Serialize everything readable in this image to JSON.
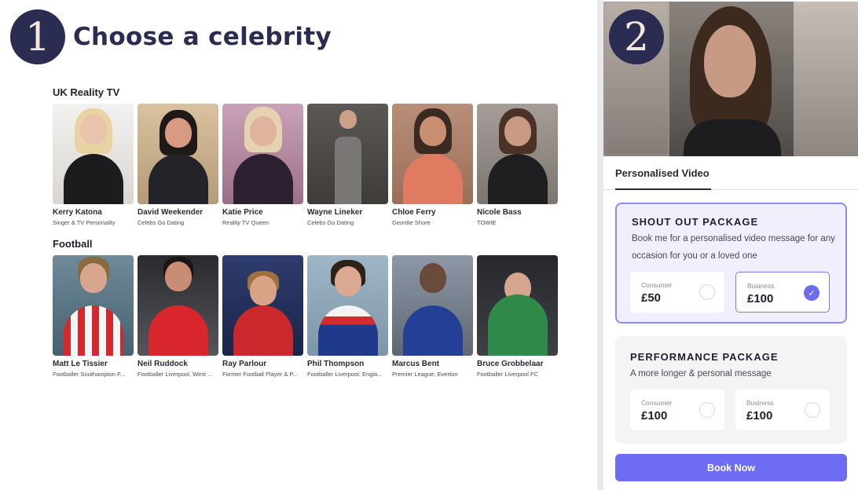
{
  "step1": {
    "number": "1",
    "title": "Choose a celebrity"
  },
  "step2": {
    "number": "2"
  },
  "sections": [
    {
      "title": "UK Reality TV",
      "celebs": [
        {
          "name": "Kerry Katona",
          "subtitle": "Singer & TV Personality"
        },
        {
          "name": "David Weekender",
          "subtitle": "Celebs Go Dating"
        },
        {
          "name": "Katie Price",
          "subtitle": "Reality TV Queen"
        },
        {
          "name": "Wayne Lineker",
          "subtitle": "Celebs Go Dating"
        },
        {
          "name": "Chloe Ferry",
          "subtitle": "Geordie Shore"
        },
        {
          "name": "Nicole Bass",
          "subtitle": "TOWIE"
        }
      ]
    },
    {
      "title": "Football",
      "celebs": [
        {
          "name": "Matt Le Tissier",
          "subtitle": "Footballer Southampton F..."
        },
        {
          "name": "Neil Ruddock",
          "subtitle": "Footballer Liverpool, West ..."
        },
        {
          "name": "Ray Parlour",
          "subtitle": "Former Football Player & P..."
        },
        {
          "name": "Phil Thompson",
          "subtitle": "Footballer Liverpool, Engla..."
        },
        {
          "name": "Marcus Bent",
          "subtitle": "Premier League, Everton"
        },
        {
          "name": "Bruce Grobbelaar",
          "subtitle": "Footballer Liverpool FC"
        }
      ]
    }
  ],
  "tab": {
    "label": "Personalised Video"
  },
  "packages": [
    {
      "title": "SHOUT OUT PACKAGE",
      "description": "Book me for a personalised video message for any occasion for you or a loved one",
      "options": [
        {
          "label": "Consumer",
          "price": "£50",
          "selected": false
        },
        {
          "label": "Business",
          "price": "£100",
          "selected": true
        }
      ]
    },
    {
      "title": "PERFORMANCE PACKAGE",
      "description": "A more longer & personal message",
      "options": [
        {
          "label": "Consumer",
          "price": "£100",
          "selected": false
        },
        {
          "label": "Business",
          "price": "£100",
          "selected": false
        }
      ]
    }
  ],
  "book_button": {
    "label": "Book Now"
  },
  "colors": {
    "step_circle": "#2b2c52",
    "accent": "#6d6cf2"
  },
  "icons": {
    "selected_radio": "check-icon"
  }
}
